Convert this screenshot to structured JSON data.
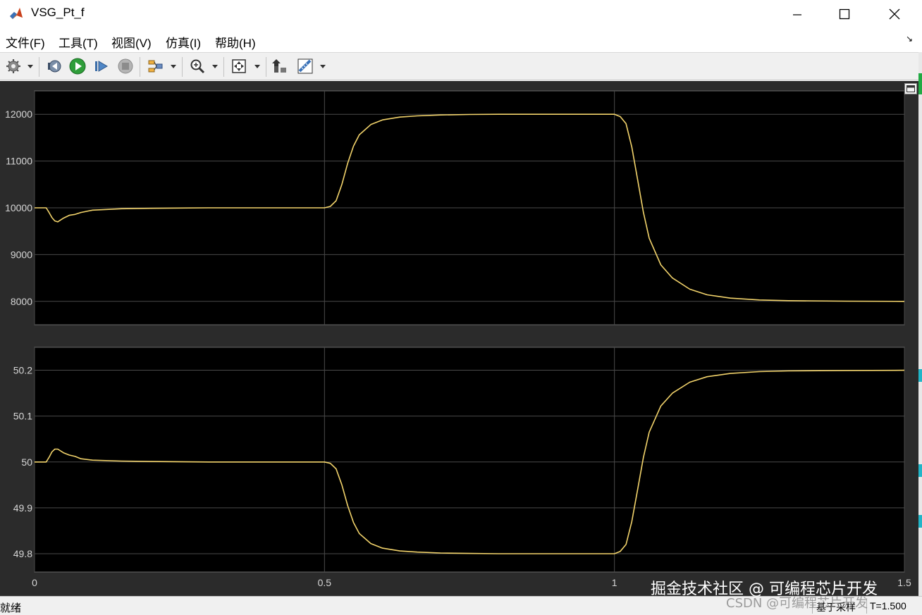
{
  "window": {
    "title": "VSG_Pt_f"
  },
  "menu": {
    "items": [
      "文件(F)",
      "工具(T)",
      "视图(V)",
      "仿真(I)",
      "帮助(H)"
    ],
    "overflow_glyph": "↘"
  },
  "toolbar": {
    "icons": [
      "gear-icon",
      "step-back-icon",
      "run-icon",
      "step-forward-icon",
      "stop-icon",
      "layout-icon",
      "zoom-icon",
      "fit-to-view-icon",
      "highlight-icon",
      "measure-icon"
    ]
  },
  "colors": {
    "plot_background": "#000000",
    "figure_background": "#2b2b2b",
    "trace": "#f2d36b",
    "grid": "#4a4a4a",
    "tick_text": "#d6d6d6"
  },
  "chart_data": [
    {
      "type": "line",
      "title": "",
      "xlabel": "",
      "ylabel": "",
      "xlim": [
        0,
        1.5
      ],
      "ylim": [
        7500,
        12500
      ],
      "xticks": [
        0,
        0.5,
        1,
        1.5
      ],
      "yticks": [
        8000,
        9000,
        10000,
        11000,
        12000
      ],
      "ytick_labels": [
        "8000",
        "9000",
        "10000",
        "11000",
        "12000"
      ],
      "grid": true,
      "series": [
        {
          "x": [
            0,
            0.02,
            0.025,
            0.03,
            0.035,
            0.04,
            0.05,
            0.06,
            0.07,
            0.08,
            0.1,
            0.15,
            0.2,
            0.3,
            0.4,
            0.5,
            0.51,
            0.52,
            0.53,
            0.54,
            0.55,
            0.56,
            0.58,
            0.6,
            0.63,
            0.66,
            0.7,
            0.75,
            0.8,
            0.9,
            1.0,
            1.01,
            1.02,
            1.03,
            1.04,
            1.05,
            1.06,
            1.08,
            1.1,
            1.13,
            1.16,
            1.2,
            1.25,
            1.3,
            1.4,
            1.5
          ],
          "values": [
            10000,
            10000,
            9900,
            9790,
            9720,
            9700,
            9780,
            9840,
            9860,
            9900,
            9950,
            9980,
            9990,
            10000,
            10000,
            10000,
            10030,
            10150,
            10500,
            10950,
            11320,
            11560,
            11780,
            11880,
            11940,
            11965,
            11985,
            11995,
            12000,
            12000,
            12000,
            11950,
            11800,
            11300,
            10600,
            9900,
            9350,
            8780,
            8500,
            8260,
            8140,
            8070,
            8030,
            8015,
            8005,
            8000
          ]
        }
      ]
    },
    {
      "type": "line",
      "title": "",
      "xlabel": "",
      "ylabel": "",
      "xlim": [
        0,
        1.5
      ],
      "ylim": [
        49.76,
        50.25
      ],
      "xticks": [
        0,
        0.5,
        1,
        1.5
      ],
      "xtick_labels": [
        "0",
        "0.5",
        "1",
        "1.5"
      ],
      "yticks": [
        49.8,
        49.9,
        50,
        50.1,
        50.2
      ],
      "ytick_labels": [
        "49.8",
        "49.9",
        "50",
        "50.1",
        "50.2"
      ],
      "grid": true,
      "series": [
        {
          "x": [
            0,
            0.02,
            0.025,
            0.03,
            0.035,
            0.04,
            0.05,
            0.06,
            0.07,
            0.08,
            0.1,
            0.15,
            0.2,
            0.3,
            0.4,
            0.5,
            0.51,
            0.52,
            0.53,
            0.54,
            0.55,
            0.56,
            0.58,
            0.6,
            0.63,
            0.66,
            0.7,
            0.75,
            0.8,
            0.9,
            1.0,
            1.01,
            1.02,
            1.03,
            1.04,
            1.05,
            1.06,
            1.08,
            1.1,
            1.13,
            1.16,
            1.2,
            1.25,
            1.3,
            1.4,
            1.5
          ],
          "values": [
            50,
            50,
            50.01,
            50.022,
            50.028,
            50.028,
            50.02,
            50.015,
            50.012,
            50.007,
            50.004,
            50.002,
            50.001,
            50,
            50,
            50,
            49.997,
            49.985,
            49.95,
            49.905,
            49.868,
            49.844,
            49.822,
            49.812,
            49.806,
            49.8035,
            49.8015,
            49.8005,
            49.8,
            49.8,
            49.8,
            49.805,
            49.82,
            49.87,
            49.94,
            50.01,
            50.065,
            50.122,
            50.15,
            50.174,
            50.186,
            50.193,
            50.197,
            50.1985,
            50.1995,
            50.2
          ]
        }
      ]
    }
  ],
  "status": {
    "left": "就绪",
    "mode": "基于采样",
    "time": "T=1.500"
  },
  "watermark": {
    "main": "掘金技术社区 @ 可编程芯片开发",
    "secondary": "CSDN @可编程芯片开发"
  }
}
